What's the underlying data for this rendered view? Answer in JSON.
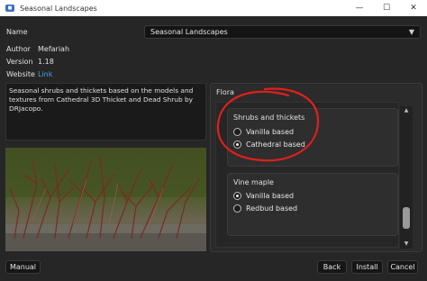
{
  "window": {
    "title": "Seasonal Landscapes",
    "minimize": "—",
    "maximize": "☐",
    "close": "✕"
  },
  "info": {
    "name_label": "Name",
    "name_value": "Seasonal Landscapes",
    "author_label": "Author",
    "author_value": "Mefariah",
    "version_label": "Version",
    "version_value": "1.18",
    "website_label": "Website",
    "website_value": "Link"
  },
  "description": "Seasonal shrubs and thickets based on the models and textures from Cathedral 3D Thicket and Dead Shrub by DRJacopo.",
  "flora": {
    "title": "Flora",
    "groups": [
      {
        "title": "Shrubs and thickets",
        "options": [
          {
            "label": "Vanilla based",
            "checked": false
          },
          {
            "label": "Cathedral based",
            "checked": true
          }
        ]
      },
      {
        "title": "Vine maple",
        "options": [
          {
            "label": "Vanilla based",
            "checked": true
          },
          {
            "label": "Redbud based",
            "checked": false
          }
        ]
      }
    ]
  },
  "buttons": {
    "manual": "Manual",
    "back": "Back",
    "install": "Install",
    "cancel": "Cancel"
  },
  "colors": {
    "annotation": "#e0201c",
    "link": "#4aa3df"
  }
}
